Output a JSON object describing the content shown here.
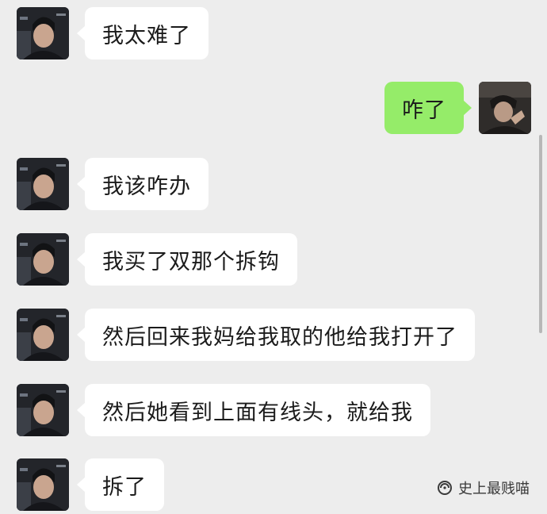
{
  "messages": [
    {
      "side": "in",
      "text": "我太难了",
      "avatar_icon": "contact-avatar-icon"
    },
    {
      "side": "out",
      "text": "咋了",
      "avatar_icon": "self-avatar-icon"
    },
    {
      "side": "in",
      "text": "我该咋办",
      "avatar_icon": "contact-avatar-icon"
    },
    {
      "side": "in",
      "text": "我买了双那个拆钩",
      "avatar_icon": "contact-avatar-icon"
    },
    {
      "side": "in",
      "text": "然后回来我妈给我取的他给我打开了",
      "avatar_icon": "contact-avatar-icon"
    },
    {
      "side": "in",
      "text": "然后她看到上面有线头，就给我",
      "avatar_icon": "contact-avatar-icon"
    },
    {
      "side": "in",
      "text": "拆了",
      "avatar_icon": "contact-avatar-icon"
    }
  ],
  "watermark": {
    "icon": "wechat-official-account-icon",
    "text": "史上最贱喵"
  },
  "colors": {
    "background": "#ededed",
    "incoming_bubble": "#ffffff",
    "outgoing_bubble": "#95ec69"
  }
}
